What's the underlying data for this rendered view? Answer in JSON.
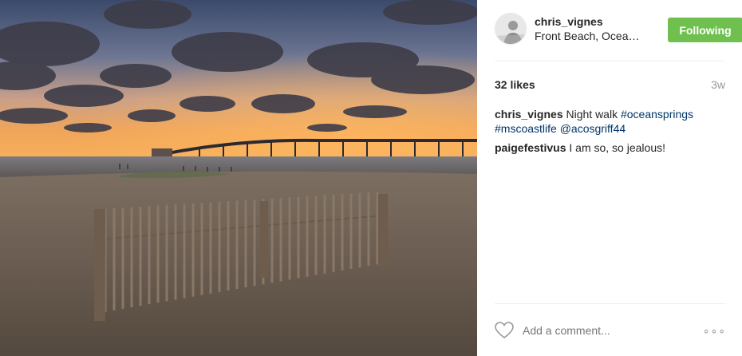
{
  "post": {
    "image_alt": "Sunset over beach with fence and bridge"
  },
  "header": {
    "username": "chris_vignes",
    "location": "Front Beach, Ocean Springs",
    "follow_label": "Following",
    "follow_color": "#70c050"
  },
  "stats": {
    "likes": "32 likes",
    "age": "3w"
  },
  "comments": [
    {
      "user": "chris_vignes",
      "text": "Night walk",
      "tags": [
        "#oceansprings",
        "#mscoastlife",
        "@acosgriff44"
      ]
    },
    {
      "user": "paigefestivus",
      "text": "I am so, so jealous!"
    }
  ],
  "footer": {
    "heart_icon": "heart-outline-icon",
    "comment_placeholder": "Add a comment...",
    "more_label": "∘∘∘"
  },
  "colors": {
    "link": "#003569",
    "muted": "#999999"
  }
}
